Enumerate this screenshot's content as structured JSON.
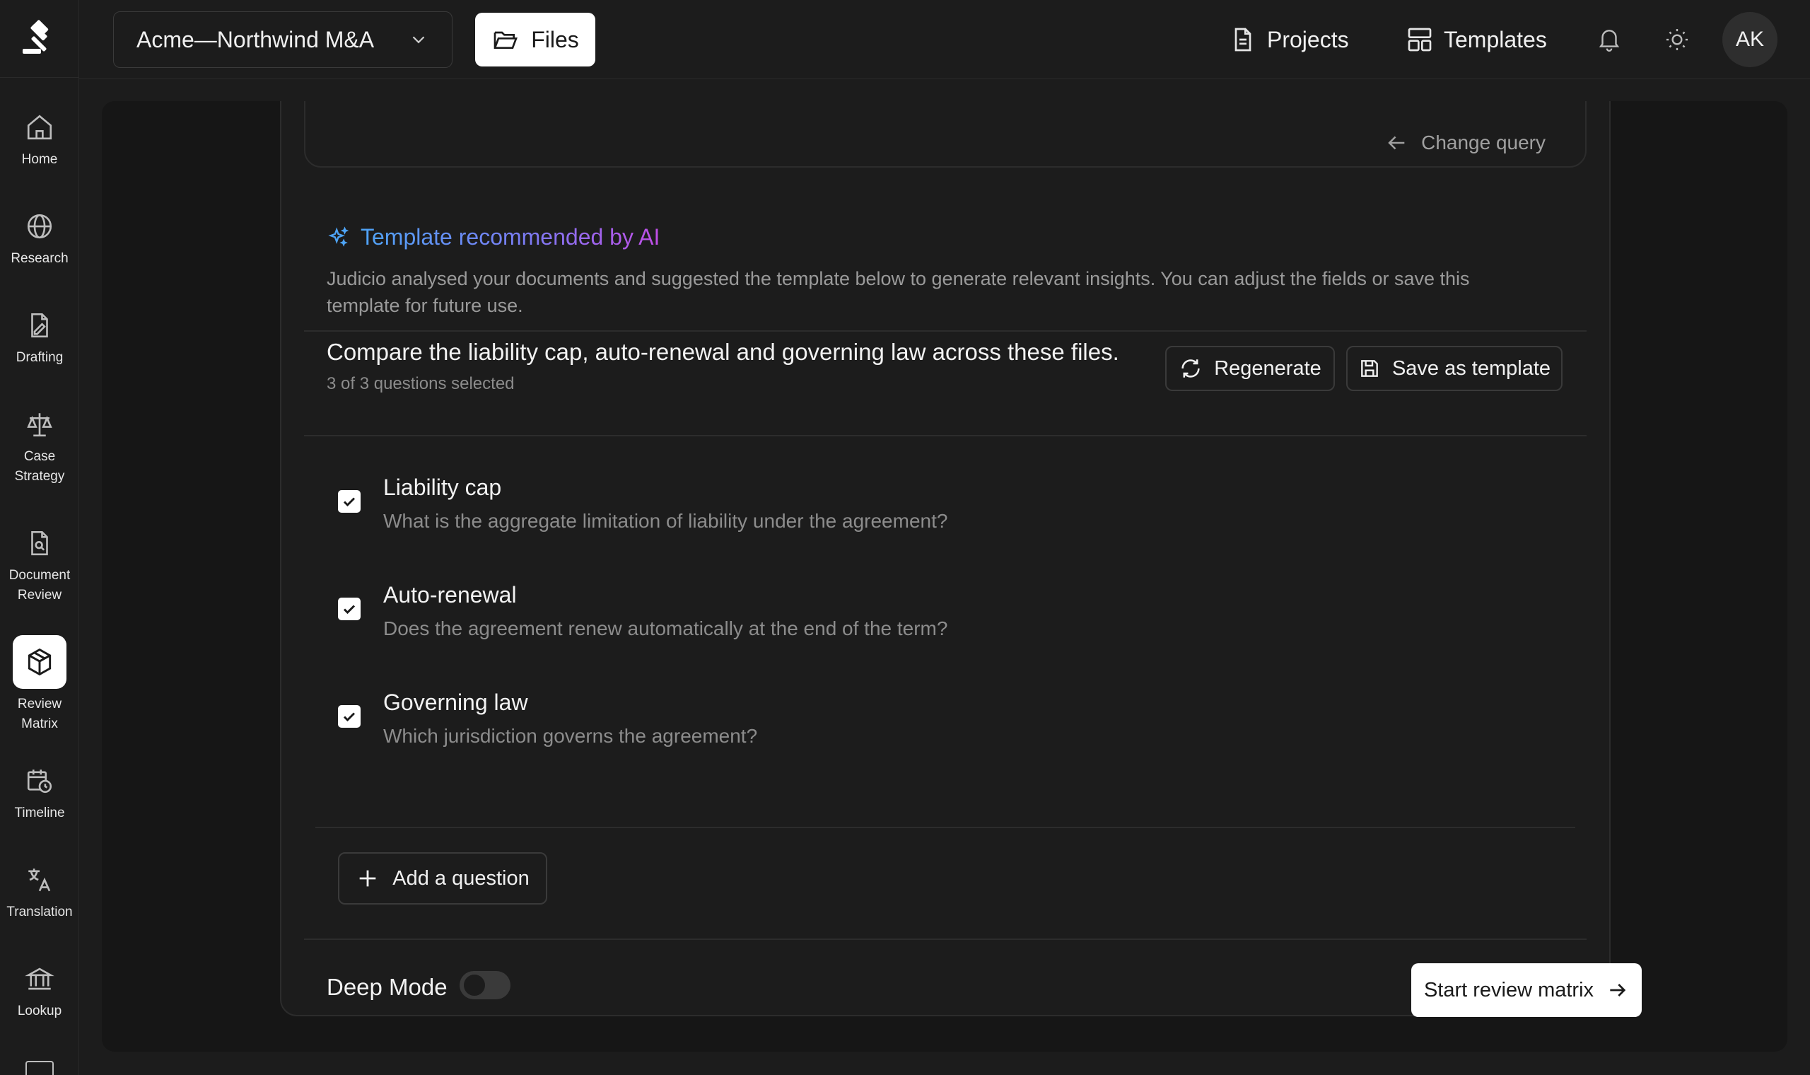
{
  "sidebar": {
    "items": [
      {
        "label": "Home",
        "icon": "home-icon"
      },
      {
        "label": "Research",
        "icon": "globe-icon"
      },
      {
        "label": "Drafting",
        "icon": "pen-document-icon"
      },
      {
        "label": "Case Strategy",
        "icon": "scales-icon"
      },
      {
        "label": "Document Review",
        "icon": "document-search-icon"
      },
      {
        "label": "Review Matrix",
        "icon": "cube-icon",
        "active": true
      },
      {
        "label": "Timeline",
        "icon": "calendar-clock-icon"
      },
      {
        "label": "Translation",
        "icon": "translate-icon"
      },
      {
        "label": "Lookup",
        "icon": "bank-icon"
      }
    ]
  },
  "topbar": {
    "workspace": "Acme—Northwind M&A",
    "files": "Files",
    "projects": "Projects",
    "templates": "Templates",
    "avatar": "AK"
  },
  "query": {
    "change_query": "Change query"
  },
  "ai": {
    "title": "Template recommended by AI",
    "description": "Judicio analysed your documents and suggested the template below to generate relevant insights. You can adjust the fields or save this template for future use."
  },
  "prompt": {
    "text": "Compare the liability cap, auto-renewal and governing law across these files.",
    "selected": "3 of 3 questions selected",
    "regenerate": "Regenerate",
    "save_template": "Save as template"
  },
  "questions": [
    {
      "title": "Liability cap",
      "desc": "What is the aggregate limitation of liability under the agreement?",
      "checked": true
    },
    {
      "title": "Auto-renewal",
      "desc": "Does the agreement renew automatically at the end of the term?",
      "checked": true
    },
    {
      "title": "Governing law",
      "desc": "Which jurisdiction governs the agreement?",
      "checked": true
    }
  ],
  "add_question": "Add a question",
  "footer": {
    "deep_mode": "Deep Mode",
    "deep_mode_on": false,
    "start": "Start review matrix"
  },
  "colors": {
    "background": "#1c1c1c",
    "panel": "#161616",
    "ai_gradient_start": "#4ea4f6",
    "ai_gradient_end": "#c04ee6"
  }
}
